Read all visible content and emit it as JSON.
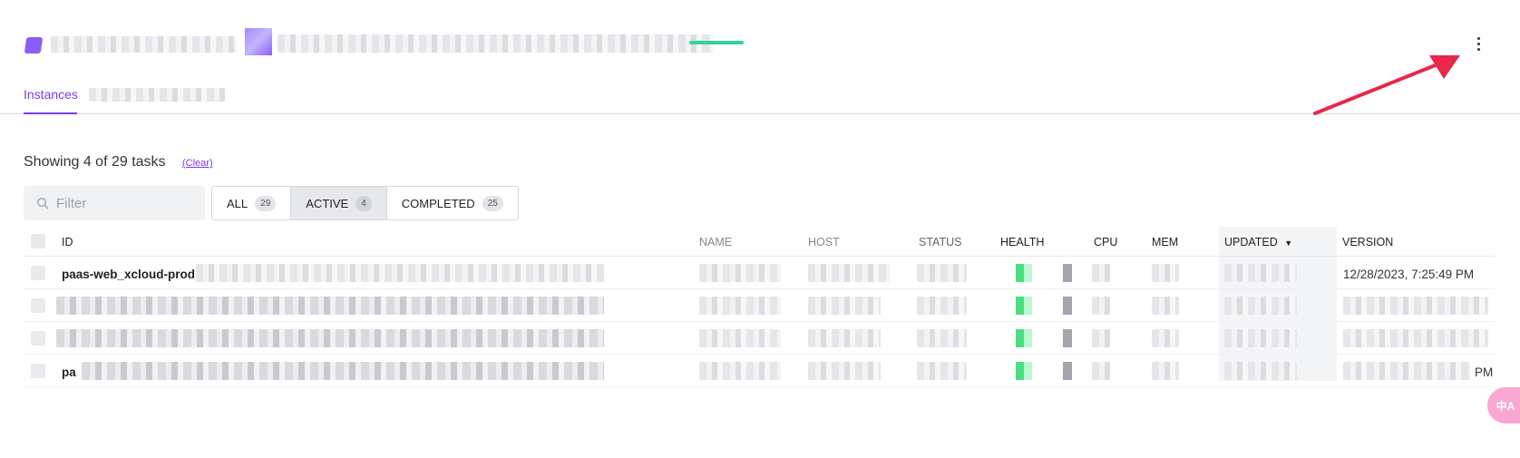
{
  "header": {
    "menu_icon": "kebab-vertical-icon"
  },
  "tabs": [
    {
      "label": "Instances",
      "active": true
    }
  ],
  "summary": {
    "text": "Showing 4 of 29 tasks",
    "clear_label": "(Clear)"
  },
  "filter": {
    "placeholder": "Filter",
    "icon": "search-icon"
  },
  "segments": [
    {
      "label": "ALL",
      "count": "29",
      "active": false
    },
    {
      "label": "ACTIVE",
      "count": "4",
      "active": true
    },
    {
      "label": "COMPLETED",
      "count": "25",
      "active": false
    }
  ],
  "table": {
    "columns": [
      "ID",
      "NAME",
      "HOST",
      "STATUS",
      "HEALTH",
      "CPU",
      "MEM",
      "UPDATED",
      "VERSION"
    ],
    "sort_column": "UPDATED",
    "sort_direction": "desc",
    "rows": [
      {
        "id": "paas-web_xcloud-prod",
        "updated": "12/28/2023, 7:25:49 PM"
      },
      {
        "id": "",
        "updated": ""
      },
      {
        "id": "",
        "updated": ""
      },
      {
        "id": "pa",
        "updated": "PM"
      }
    ]
  },
  "colors": {
    "accent": "#7c3aed",
    "health": "#4ade80",
    "annotation_arrow": "#e8274b"
  },
  "fab": {
    "icon": "translate-icon",
    "label": "中A"
  }
}
